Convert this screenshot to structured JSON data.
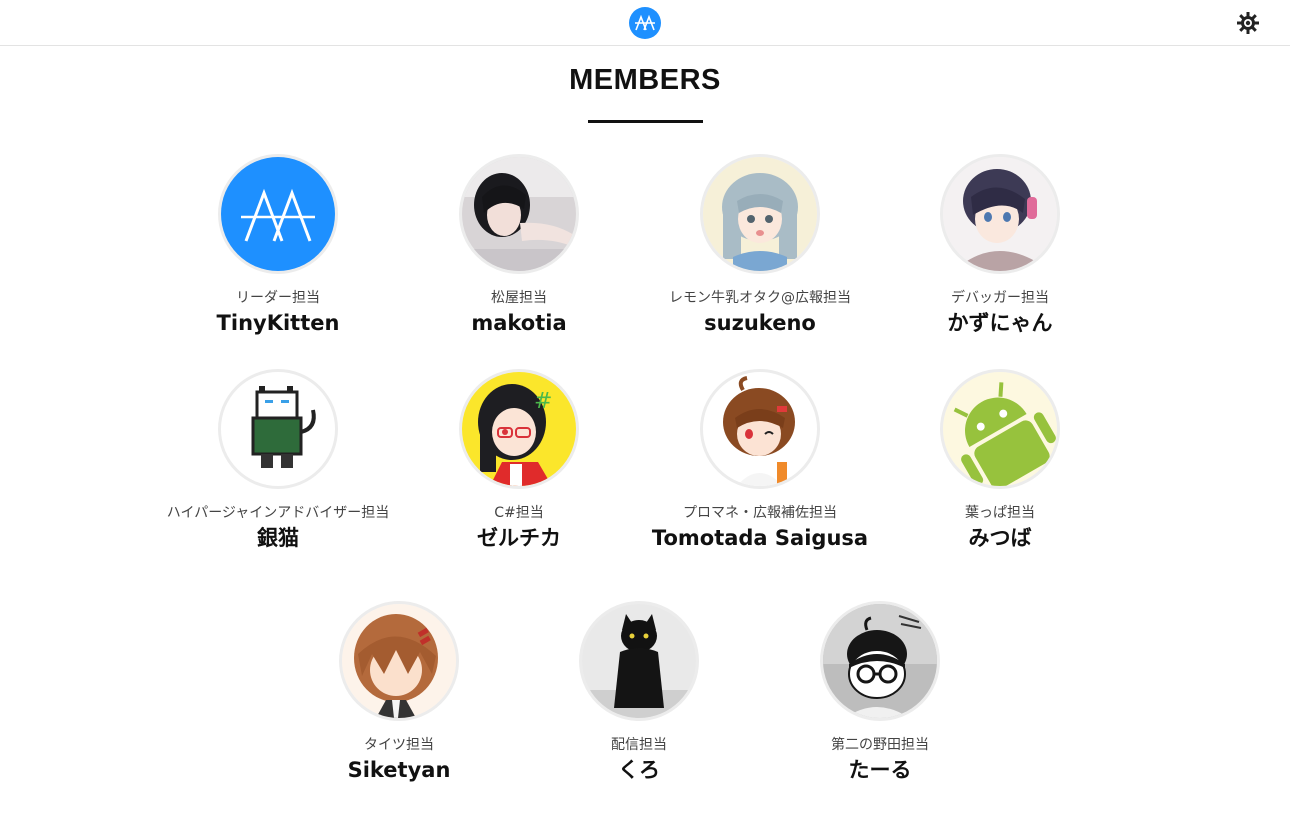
{
  "header": {
    "logo_icon": "aa-logo-icon",
    "settings_icon": "gear-icon",
    "accent_color": "#1e90ff"
  },
  "section": {
    "title": "MEMBERS"
  },
  "members": [
    {
      "role": "リーダー担当",
      "name": "TinyKitten",
      "avatar": "aa-logo-icon"
    },
    {
      "role": "松屋担当",
      "name": "makotia",
      "avatar": "photo-avatar"
    },
    {
      "role": "レモン牛乳オタク@広報担当",
      "name": "suzukeno",
      "avatar": "illustration-avatar"
    },
    {
      "role": "デバッガー担当",
      "name": "かずにゃん",
      "avatar": "illustration-avatar"
    },
    {
      "role": "ハイパージャインアドバイザー担当",
      "name": "銀猫",
      "avatar": "pixel-cat-avatar"
    },
    {
      "role": "C#担当",
      "name": "ゼルチカ",
      "avatar": "illustration-avatar"
    },
    {
      "role": "プロマネ・広報補佐担当",
      "name": "Tomotada Saigusa",
      "avatar": "illustration-avatar"
    },
    {
      "role": "葉っぱ担当",
      "name": "みつば",
      "avatar": "android-avatar"
    },
    {
      "role": "タイツ担当",
      "name": "Siketyan",
      "avatar": "illustration-avatar"
    },
    {
      "role": "配信担当",
      "name": "くろ",
      "avatar": "black-cat-photo-avatar"
    },
    {
      "role": "第二の野田担当",
      "name": "たーる",
      "avatar": "glasses-character-avatar"
    }
  ]
}
